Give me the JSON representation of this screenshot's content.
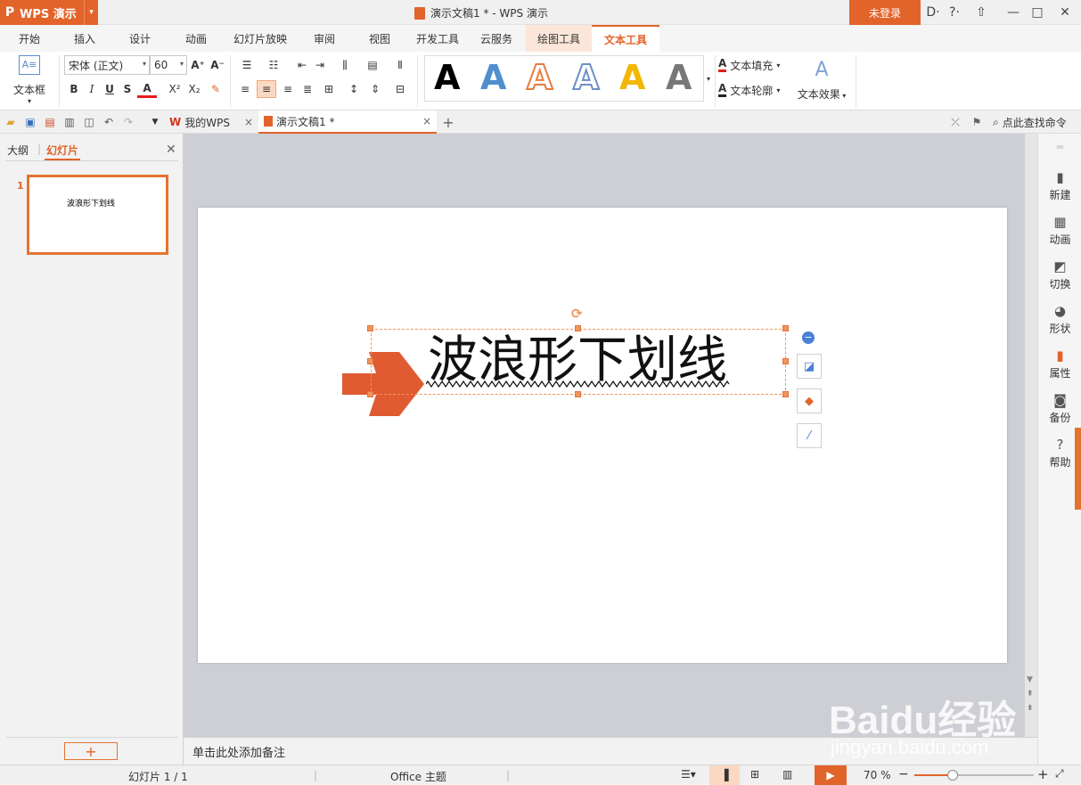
{
  "app": {
    "logo": "P",
    "name": "WPS 演示",
    "title": "演示文稿1 * - WPS 演示",
    "login": "未登录"
  },
  "window_controls": [
    "D·",
    "?·",
    "⇧",
    "—",
    "□",
    "✕"
  ],
  "tabs": [
    "开始",
    "插入",
    "设计",
    "动画",
    "幻灯片放映",
    "审阅",
    "视图",
    "开发工具",
    "云服务",
    "绘图工具",
    "文本工具"
  ],
  "ribbon": {
    "textbox_label": "文本框",
    "font_name": "宋体 (正文)",
    "font_size": "60",
    "grow_font": "A⁺",
    "shrink_font": "A⁻",
    "format_buttons": [
      "B",
      "I",
      "U",
      "S",
      "A",
      "X²",
      "X₂"
    ],
    "style_gallery": [
      {
        "label": "A",
        "color": "#000000"
      },
      {
        "label": "A",
        "color": "#4f8fcd"
      },
      {
        "label": "A",
        "color": "#e87d3e"
      },
      {
        "label": "A",
        "color": "#6e8fc6"
      },
      {
        "label": "A",
        "color": "#f2b705"
      },
      {
        "label": "A",
        "color": "#777777"
      }
    ],
    "text_fill": "文本填充",
    "text_outline": "文本轮廓",
    "text_effect": "文本效果"
  },
  "quickbar": {
    "tab_mywps": "我的WPS",
    "tab_doc": "演示文稿1 *",
    "find_command": "点此查找命令"
  },
  "leftpane": {
    "tab_outline": "大纲",
    "tab_slides": "幻灯片",
    "slide_number": "1",
    "thumb_text": "波浪形下划线",
    "add_button": "+"
  },
  "slide": {
    "text": "波浪形下划线"
  },
  "notes_placeholder": "单击此处添加备注",
  "rightbar": [
    "新建",
    "动画",
    "切换",
    "形状",
    "属性",
    "备份",
    "帮助"
  ],
  "status": {
    "slide_counter": "幻灯片 1 / 1",
    "theme": "Office 主题",
    "zoom": "70 %",
    "zoom_level": 0.32
  },
  "watermark": {
    "brand": "Baidu经验",
    "url": "jingyan.baidu.com"
  }
}
